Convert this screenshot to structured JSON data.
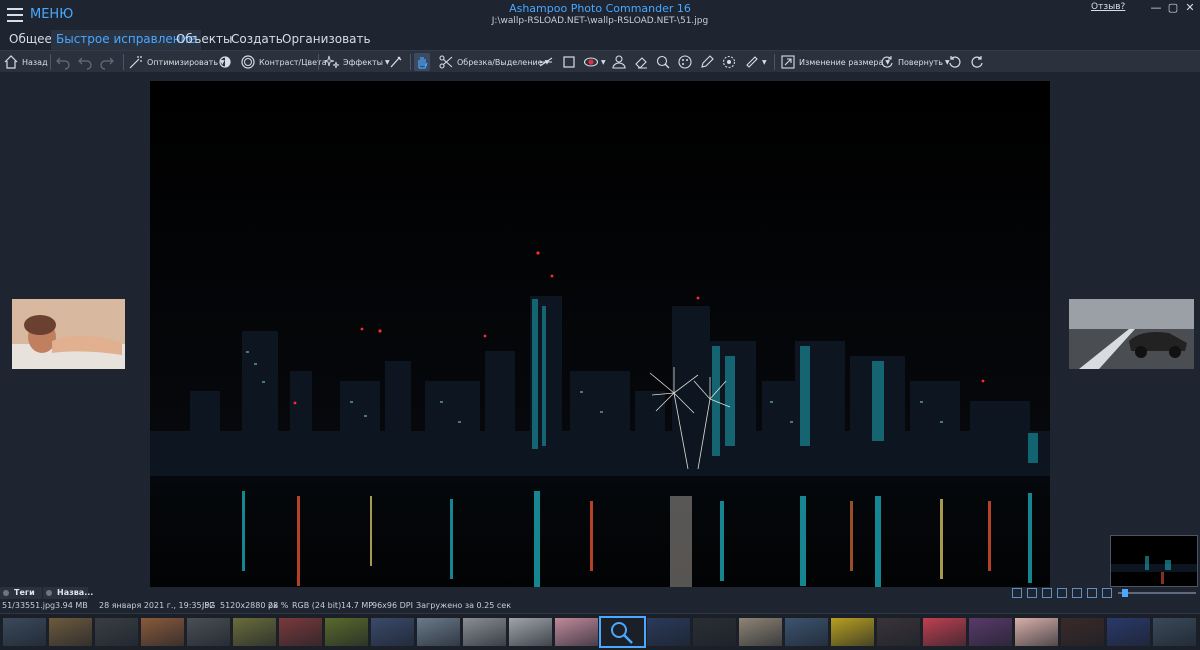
{
  "menu": {
    "label": "МЕНЮ"
  },
  "window": {
    "title": "Ashampoo Photo Commander 16",
    "path": "J:\\wallp-RSLOAD.NET-\\wallp-RSLOAD.NET-\\51.jpg",
    "feedback": "Отзыв?",
    "minimize_icon": "minimize-icon",
    "maximize_icon": "maximize-icon",
    "close_icon": "close-icon"
  },
  "tabs": [
    {
      "label": "Общее",
      "active": false
    },
    {
      "label": "Быстрое исправление",
      "active": true
    },
    {
      "label": "Объекты",
      "active": false
    },
    {
      "label": "Создать",
      "active": false
    },
    {
      "label": "Организовать",
      "active": false
    }
  ],
  "toolbar": {
    "back": "Назад",
    "optimize": "Оптимизировать",
    "contrast": "Контраст/Цвета",
    "effects": "Эффекты",
    "crop": "Обрезка/Выделение",
    "resize": "Изменение размера",
    "rotate": "Повернуть",
    "accent": "#4aa8ff"
  },
  "panel": {
    "tags": "Теги",
    "name": "Назва..."
  },
  "status": {
    "position": "51/335",
    "filename": "51.jpg",
    "filesize": "3.94 MB",
    "date": "28 января 2021 г., 19:35:52",
    "format": "JPG",
    "dimensions": "5120x2880 px",
    "zoom": "28 %",
    "colormode": "RGB (24 bit)",
    "megapixels": "14.7 MP",
    "dpi": "96x96 DPI",
    "loadtime": "Загружено за 0.25 сек"
  },
  "viewer": {
    "zoom_fraction": 0.05
  },
  "filmstrip": {
    "count": 26,
    "selected_index": 13,
    "colors": [
      "#3b4a5c",
      "#6d5a3c",
      "#3a3e44",
      "#8a5a3a",
      "#4a4f55",
      "#6a6d3a",
      "#7a3a3a",
      "#5a6a2a",
      "#3a4a6a",
      "#6a7a8a",
      "#8a8e94",
      "#a0a4aa",
      "#c08a9a",
      "#a8b0b8",
      "#2a3a5a",
      "#2a2e34",
      "#8e8474",
      "#3c5470",
      "#b8a020",
      "#3a3438",
      "#c04050",
      "#5a3a6a",
      "#d8b0a8",
      "#3a2a28",
      "#2a3a6a",
      "#3a4a5a"
    ]
  }
}
